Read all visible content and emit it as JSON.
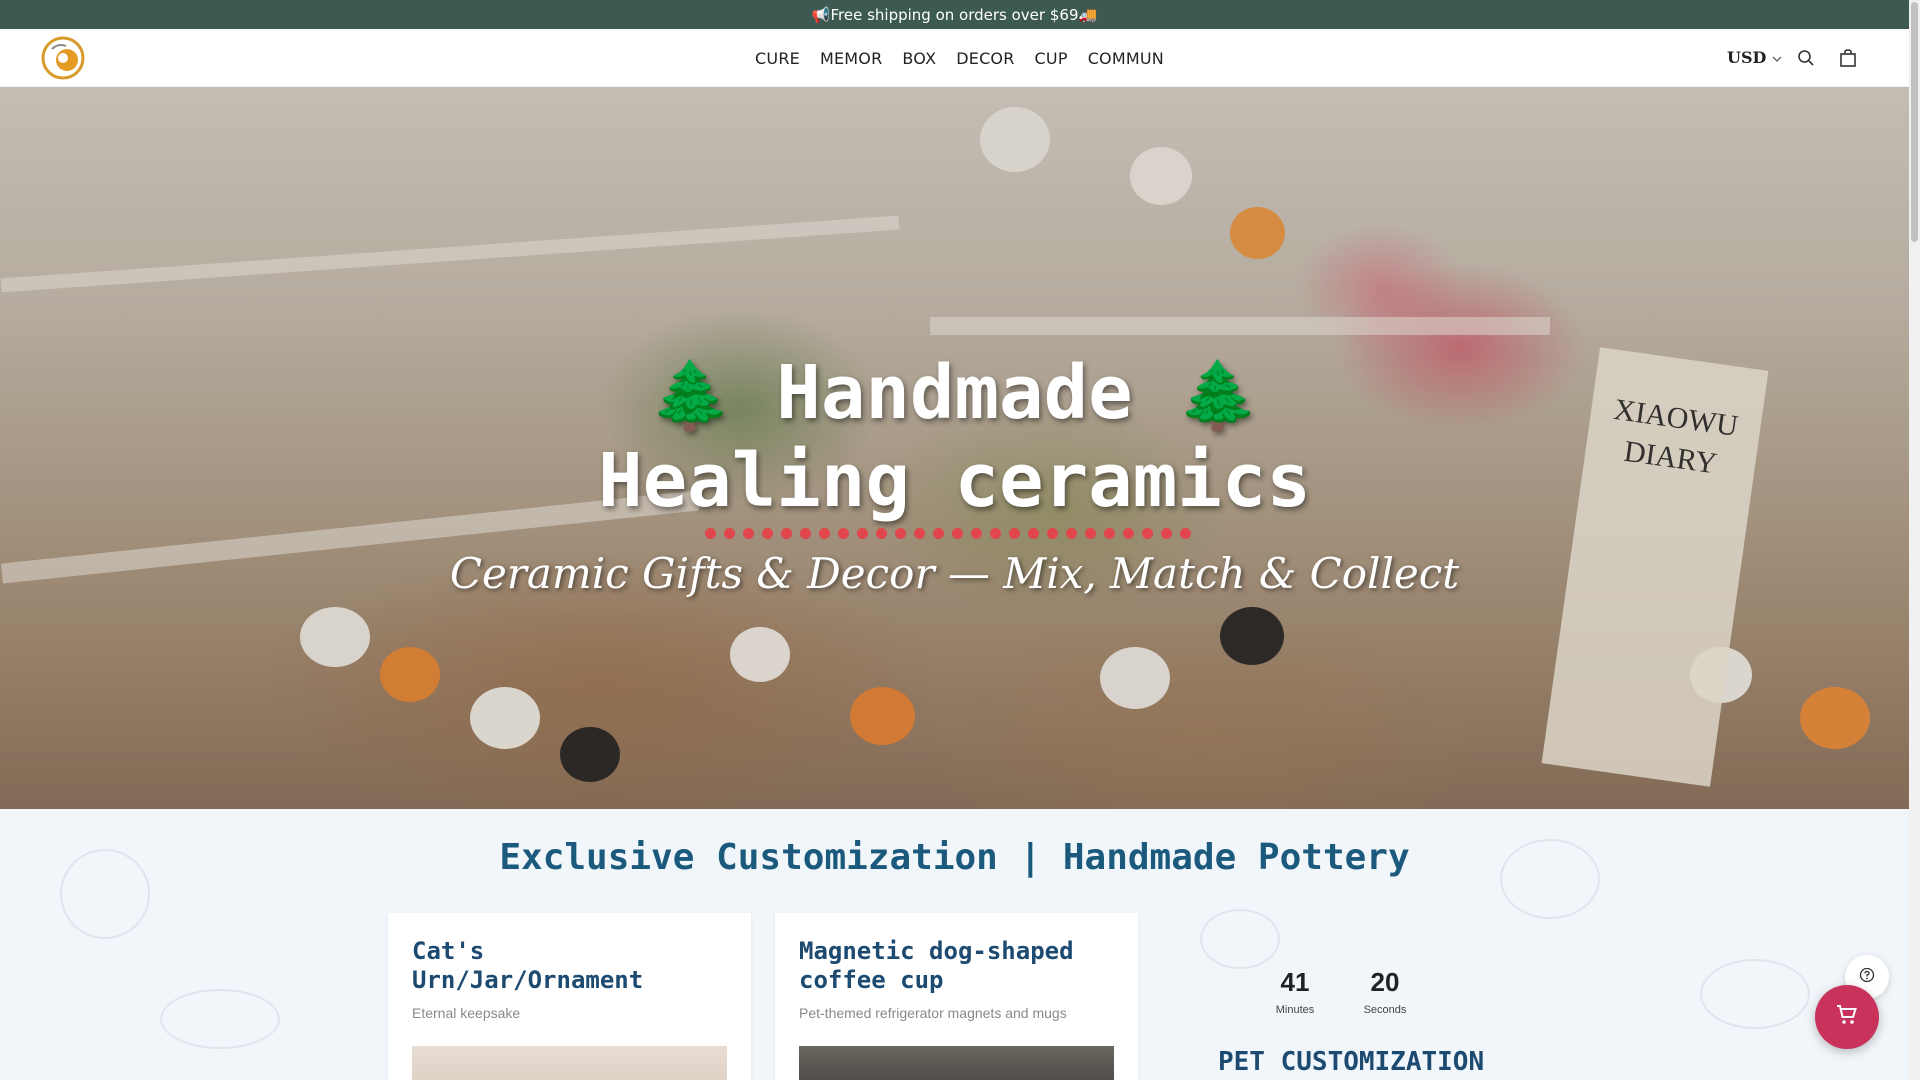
{
  "announcement": {
    "text": "📢Free shipping on orders over $69🚚"
  },
  "header": {
    "logo_alt": "store logo",
    "nav": [
      "CURE",
      "MEMOR",
      "BOX",
      "DECOR",
      "CUP",
      "COMMUN"
    ],
    "currency": "USD"
  },
  "hero": {
    "tree_emoji": "🌲",
    "title_line1": "Handmade",
    "title_line2": "Healing ceramics",
    "subtitle": "Ceramic Gifts & Decor — Mix, Match & Collect",
    "sign_text": "XIAOWU DIARY",
    "dot_color": "#e0464c"
  },
  "section": {
    "title": "Exclusive Customization | Handmade Pottery",
    "cards": [
      {
        "title": "Cat's Urn/Jar/Ornament",
        "desc": "Eternal keepsake"
      },
      {
        "title": "Magnetic dog-shaped coffee cup",
        "desc": "Pet-themed refrigerator magnets and mugs"
      }
    ],
    "countdown": {
      "minutes": "41",
      "minutes_label": "Minutes",
      "seconds": "20",
      "seconds_label": "Seconds"
    },
    "pet_title": "PET CUSTOMIZATION"
  },
  "colors": {
    "announce_bg": "#3d5a52",
    "title_blue": "#1c5a7d",
    "cart_fab": "#c8325b"
  }
}
